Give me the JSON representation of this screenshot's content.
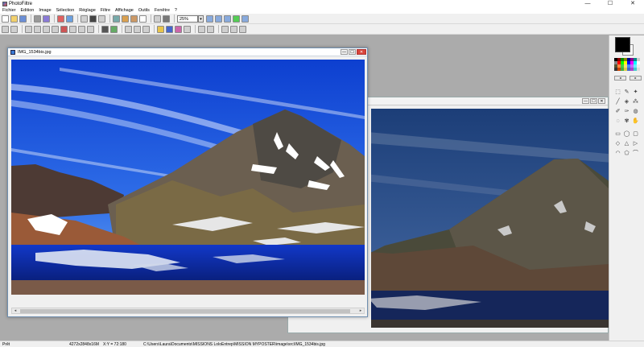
{
  "app": {
    "title": "PhotoFiltre"
  },
  "window_controls": {
    "minimize": "—",
    "maximize": "☐",
    "close": "✕"
  },
  "menu": [
    "Fichier",
    "Edition",
    "Image",
    "Sélection",
    "Réglage",
    "Filtre",
    "Affichage",
    "Outils",
    "Fenêtre",
    "?"
  ],
  "toolbar": {
    "zoom_value": "25%"
  },
  "document": {
    "name": "IMG_1534bis.jpg"
  },
  "status": {
    "state": "Prêt",
    "dimensions": "4272x2848x16M",
    "coords": "X:Y = 72:180",
    "path": "C:\\Users\\Laura\\Documents\\MISSIONS LoloEntrep\\MISSION MYPOSTER\\image\\src\\IMG_1534bis.jpg"
  },
  "colors": {
    "foreground": "#000000",
    "background": "#ffffff",
    "sky": "#1a56d6",
    "lake": "#0a1f8a"
  },
  "icons": [
    "new-icon",
    "open-icon",
    "save-icon",
    "print-icon",
    "undo-icon",
    "redo-icon",
    "zoom-in-icon",
    "zoom-out-icon",
    "text-icon",
    "brush-icon",
    "eyedropper-icon",
    "selection-icon"
  ]
}
